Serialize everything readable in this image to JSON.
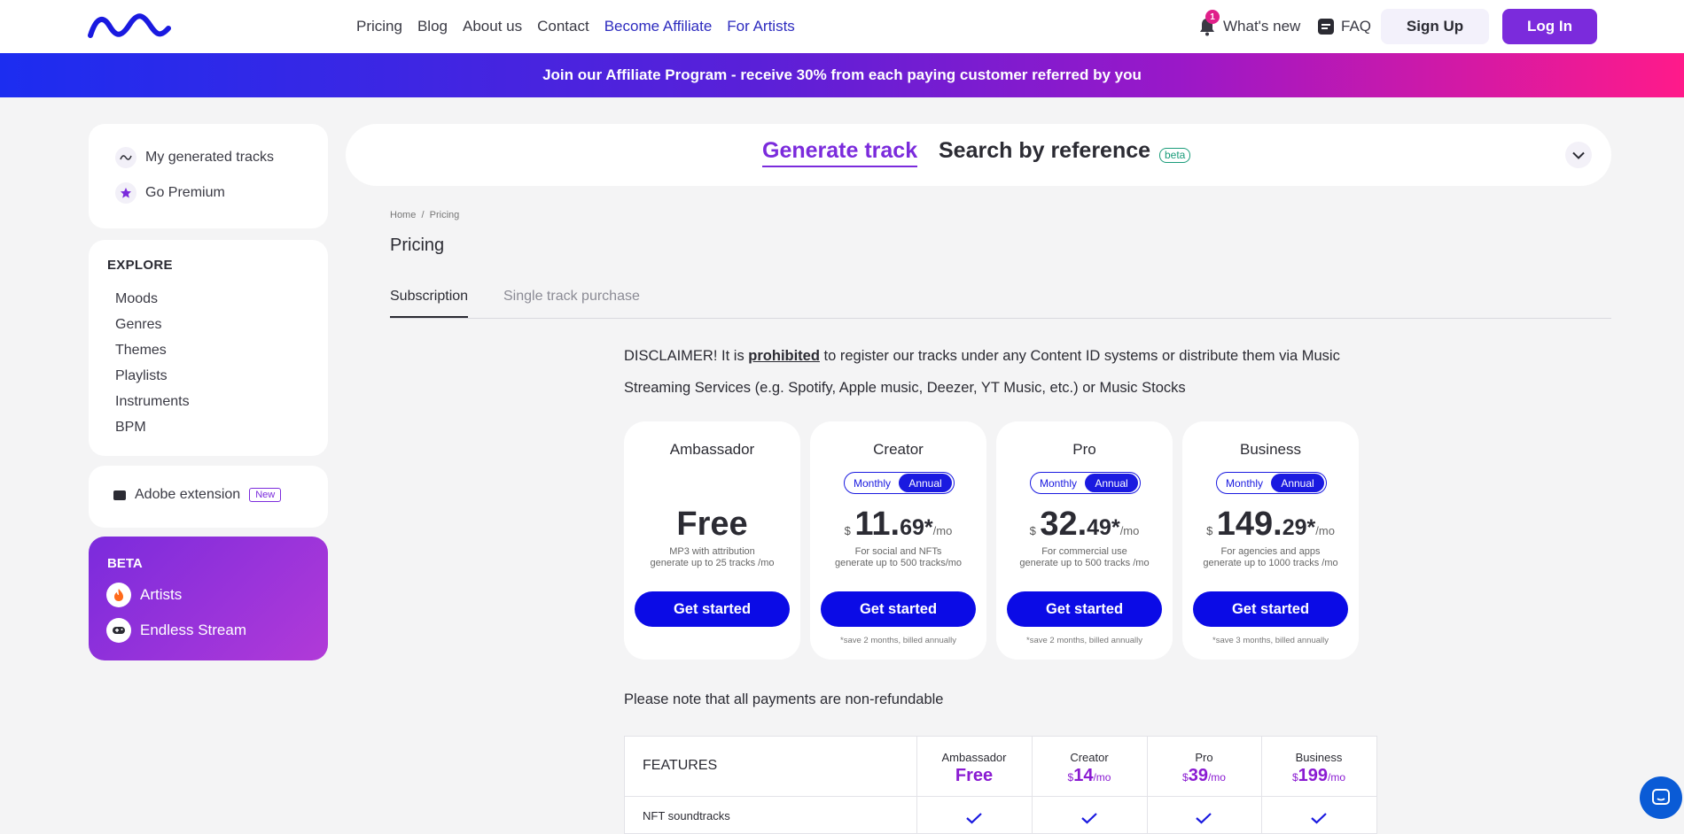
{
  "header": {
    "nav": [
      "Pricing",
      "Blog",
      "About us",
      "Contact",
      "Become Affiliate",
      "For Artists"
    ],
    "whats_new": "What's new",
    "notification_count": "1",
    "faq": "FAQ",
    "sign_up": "Sign Up",
    "log_in": "Log In"
  },
  "banner": "Join our Affiliate Program - receive 30% from each paying customer referred by you",
  "sidebar": {
    "top_items": [
      "My generated tracks",
      "Go Premium"
    ],
    "explore_title": "EXPLORE",
    "explore_items": [
      "Moods",
      "Genres",
      "Themes",
      "Playlists",
      "Instruments",
      "BPM"
    ],
    "adobe": "Adobe extension",
    "new_badge": "New",
    "beta_title": "BETA",
    "beta_items": [
      "Artists",
      "Endless Stream"
    ]
  },
  "top_tabs": {
    "generate": "Generate track",
    "search": "Search by reference",
    "beta": "beta"
  },
  "breadcrumb": "Home  /  Pricing",
  "page_title": "Pricing",
  "tabs": [
    "Subscription",
    "Single track purchase"
  ],
  "disclaimer": {
    "before": "DISCLAIMER! It is ",
    "emph": "prohibited",
    "after": " to register our tracks under any Content ID systems or distribute them via Music Streaming Services (e.g. Spotify, Apple music, Deezer, YT Music, etc.) or Music Stocks"
  },
  "plans": [
    {
      "name": "Ambassador",
      "price": "Free",
      "desc1": "MP3 with attribution",
      "desc2": "generate up to 25 tracks /mo",
      "button": "Get started",
      "note": ""
    },
    {
      "name": "Creator",
      "currency": "$",
      "whole": "11.",
      "cents": "69*",
      "per": "/mo",
      "desc1": "For social and NFTs",
      "desc2": "generate up to 500 tracks/mo",
      "button": "Get started",
      "note": "*save 2 months, billed annually"
    },
    {
      "name": "Pro",
      "currency": "$",
      "whole": "32.",
      "cents": "49*",
      "per": "/mo",
      "desc1": "For commercial use",
      "desc2": "generate up to 500 tracks /mo",
      "button": "Get started",
      "note": "*save 2 months, billed annually"
    },
    {
      "name": "Business",
      "currency": "$",
      "whole": "149.",
      "cents": "29*",
      "per": "/mo",
      "desc1": "For agencies and apps",
      "desc2": "generate up to 1000 tracks /mo",
      "button": "Get started",
      "note": "*save 3 months, billed annually"
    }
  ],
  "toggle": {
    "monthly": "Monthly",
    "annual": "Annual"
  },
  "non_refundable": "Please note that all payments are non-refundable",
  "features": {
    "label": "FEATURES",
    "columns": [
      {
        "name": "Ambassador",
        "price": "Free"
      },
      {
        "name": "Creator",
        "currency": "$",
        "price": "14",
        "per": "/mo"
      },
      {
        "name": "Pro",
        "currency": "$",
        "price": "39",
        "per": "/mo"
      },
      {
        "name": "Business",
        "currency": "$",
        "price": "199",
        "per": "/mo"
      }
    ],
    "rows": [
      "NFT soundtracks"
    ]
  },
  "colors": {
    "accent": "#7b2bdc",
    "button_blue": "#0b0be6",
    "nav_accent": "#2d2bbf"
  }
}
